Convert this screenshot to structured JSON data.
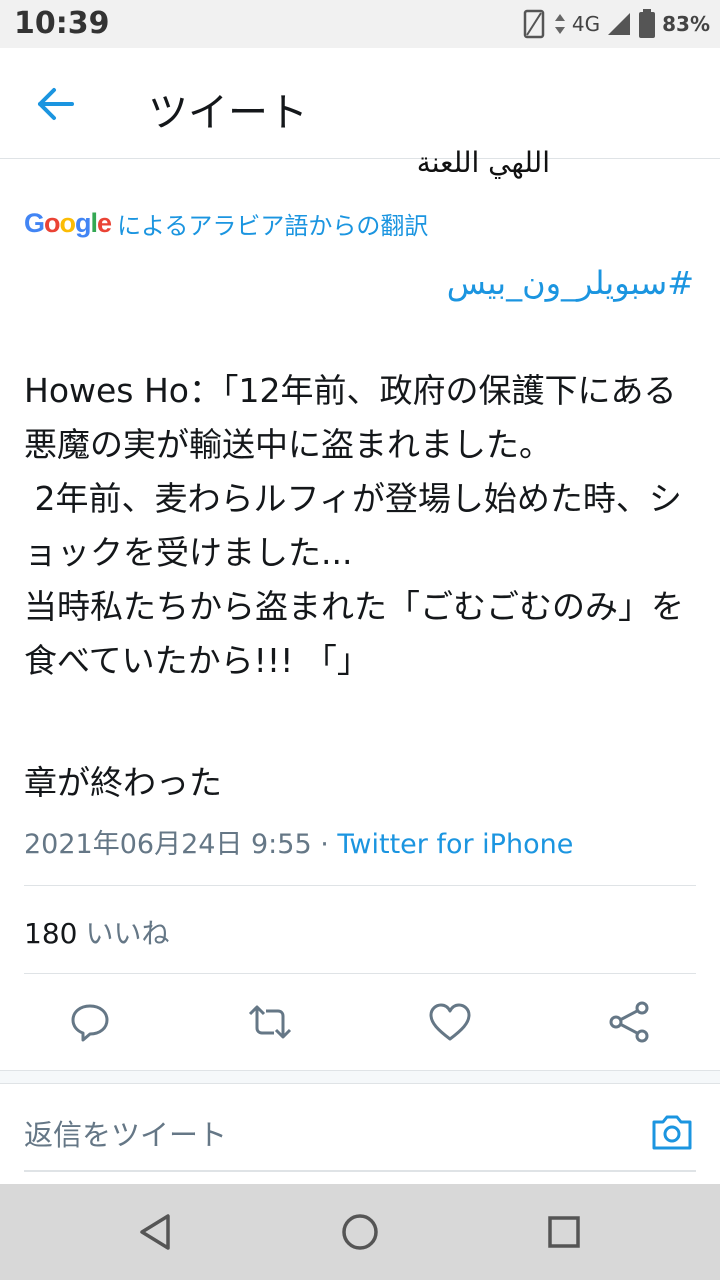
{
  "status": {
    "time": "10:39",
    "network": "4G",
    "battery": "83%"
  },
  "header": {
    "title": "ツイート"
  },
  "tweet": {
    "arabic_fragment": "اللهي اللعنة",
    "translated_by": "によるアラビア語からの翻訳",
    "google_logo": "Google",
    "hashtag": "#سبويلر_ون_بيس",
    "body": "Howes Ho：「12年前、政府の保護下にある悪魔の実が輸送中に盗まれました。\n 2年前、麦わらルフィが登場し始めた時、ショックを受けました...\n当時私たちから盗まれた「ごむごむのみ」を食べていたから!!! 「」",
    "ending": "章が終わった",
    "timestamp": "2021年06月24日 9:55",
    "separator": " · ",
    "source": "Twitter for iPhone",
    "likes_count": "180",
    "likes_label": "いいね"
  },
  "reply": {
    "placeholder": "返信をツイート"
  },
  "icons": {
    "back": "arrow-left-icon",
    "reply": "reply-icon",
    "retweet": "retweet-icon",
    "like": "heart-icon",
    "share": "share-icon",
    "camera": "camera-icon"
  },
  "colors": {
    "accent": "#1b95e0",
    "secondary": "#657786",
    "text": "#14171a"
  }
}
